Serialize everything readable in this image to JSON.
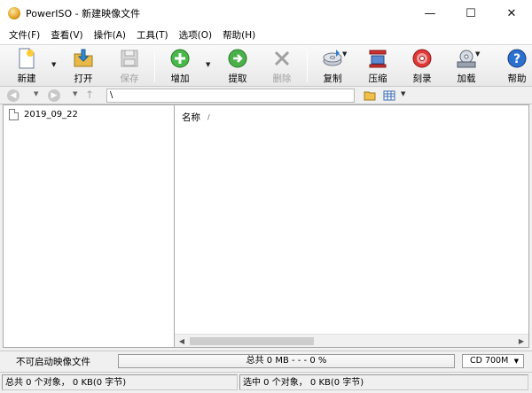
{
  "window": {
    "title": "PowerISO - 新建映像文件"
  },
  "window_controls": {
    "minimize": "—",
    "maximize": "☐",
    "close": "✕"
  },
  "menu": [
    {
      "label": "文件(F)"
    },
    {
      "label": "查看(V)"
    },
    {
      "label": "操作(A)"
    },
    {
      "label": "工具(T)"
    },
    {
      "label": "选项(O)"
    },
    {
      "label": "帮助(H)"
    }
  ],
  "toolbar": {
    "new": "新建",
    "open": "打开",
    "save": "保存",
    "add": "增加",
    "extract": "提取",
    "delete": "删除",
    "copy": "复制",
    "compress": "压缩",
    "burn": "刻录",
    "mount": "加载",
    "help": "帮助"
  },
  "addressbar": {
    "path": "\\"
  },
  "tree": {
    "items": [
      {
        "label": "2019_09_22"
      }
    ]
  },
  "list": {
    "column_name": "名称",
    "sort_glyph": "/"
  },
  "status": {
    "boot_label": "不可启动映像文件",
    "capacity_text": "总共  0 MB   - - -  0 %",
    "capacity_select": "CD 700M",
    "total_objects": "总共 0 个对象， 0 KB(0 字节)",
    "selected_objects": "选中 0 个对象， 0 KB(0 字节)"
  }
}
